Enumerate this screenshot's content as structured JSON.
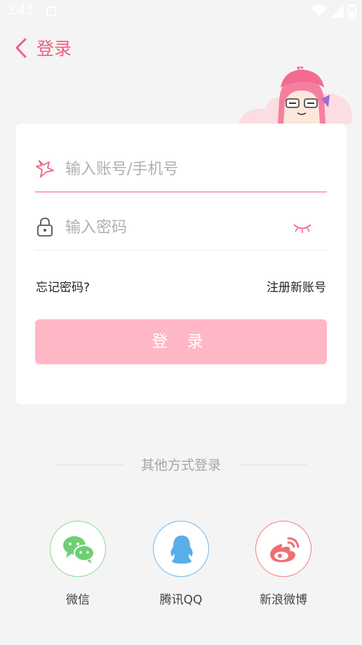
{
  "status_bar": {
    "time": "3:43"
  },
  "header": {
    "title": "登录"
  },
  "form": {
    "username_placeholder": "输入账号/手机号",
    "password_placeholder": "输入密码",
    "forgot_label": "忘记密码?",
    "register_label": "注册新账号",
    "login_label": "登 录"
  },
  "social": {
    "title": "其他方式登录",
    "items": [
      {
        "label": "微信",
        "icon": "wechat-icon"
      },
      {
        "label": "腾讯QQ",
        "icon": "qq-icon"
      },
      {
        "label": "新浪微博",
        "icon": "weibo-icon"
      }
    ]
  },
  "colors": {
    "accent": "#f0607e",
    "button_bg": "#ffb7c5",
    "wechat": "#6fcf73",
    "qq": "#5aaee8",
    "weibo": "#ef6f6f"
  }
}
